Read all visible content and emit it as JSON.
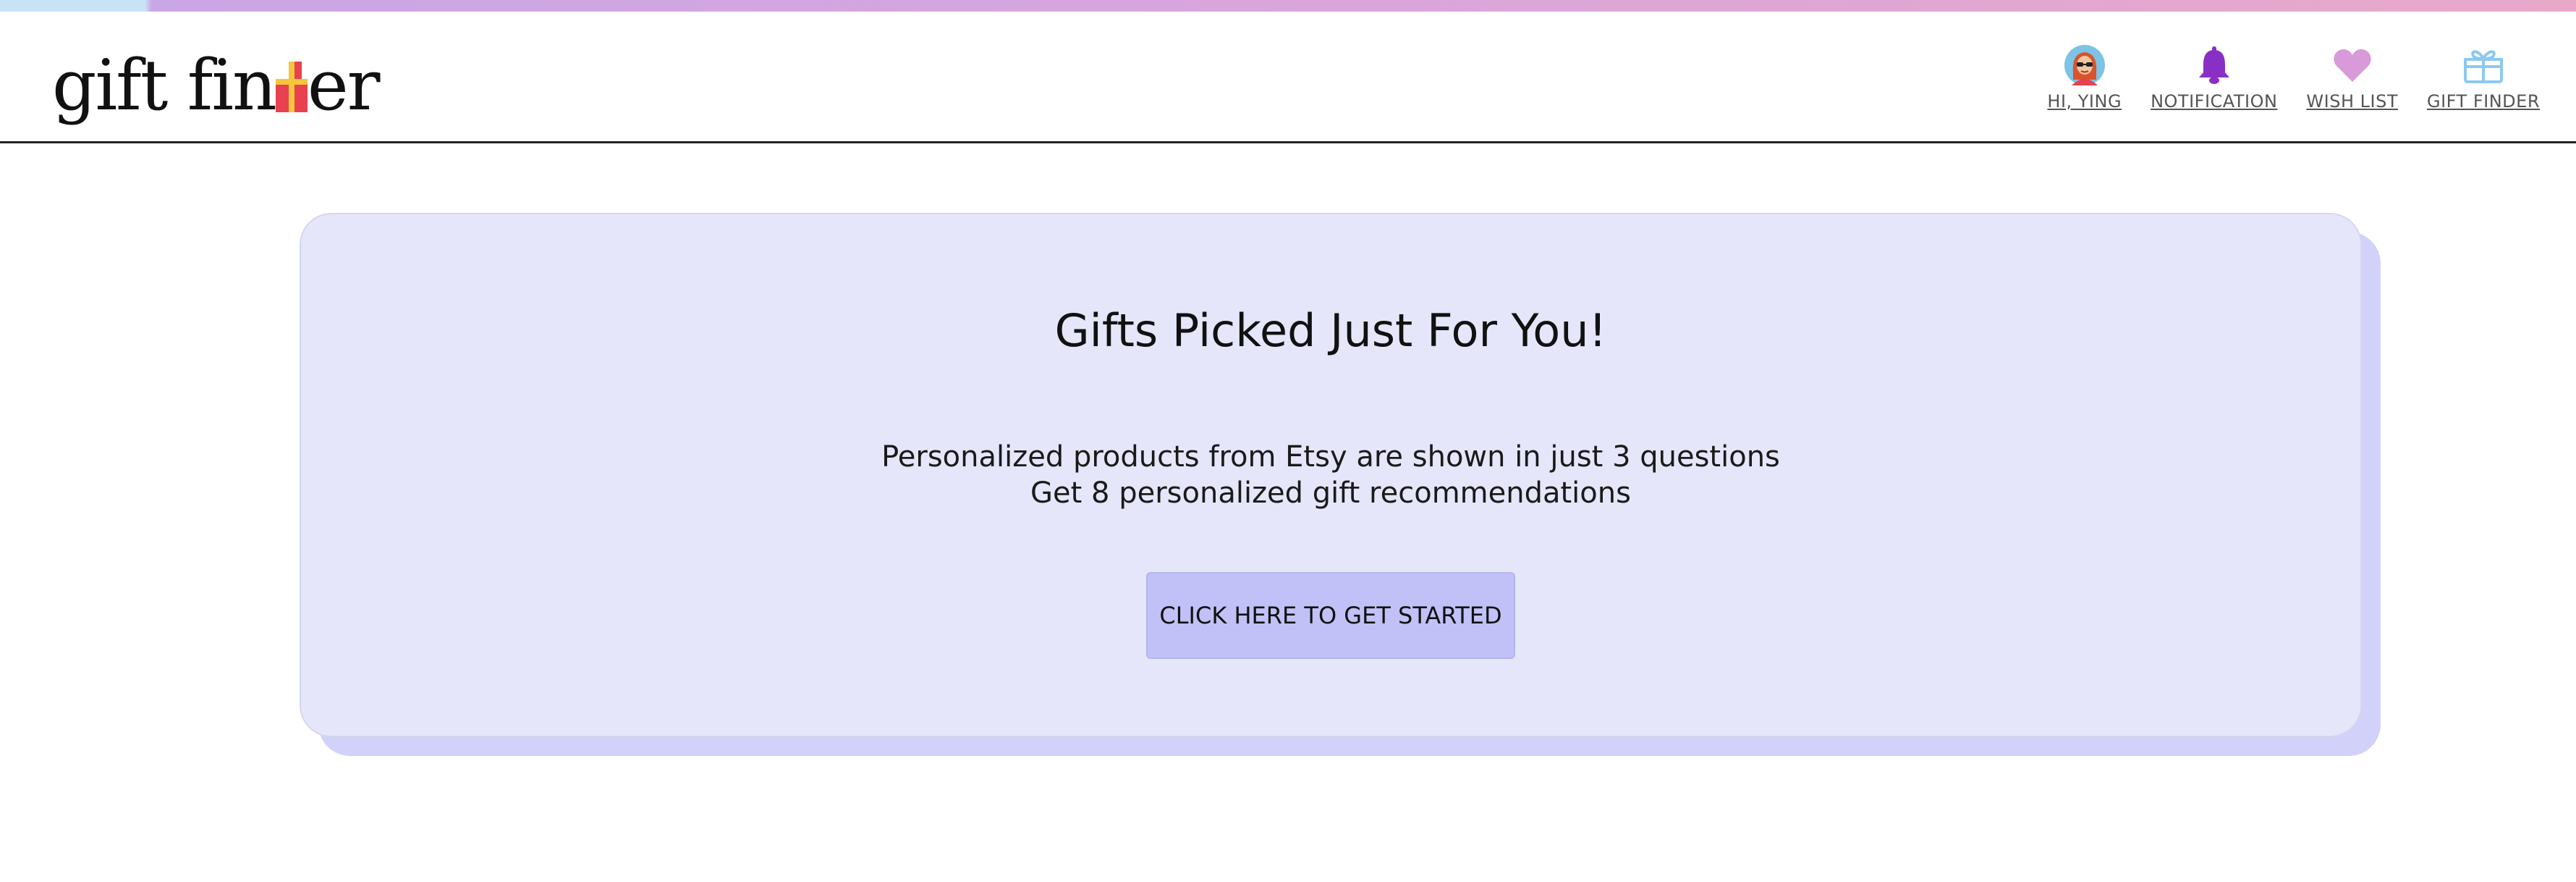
{
  "brand": {
    "logo_text_left": "gift fin",
    "logo_text_right": "er"
  },
  "nav": {
    "profile_label": "HI, YING",
    "notification_label": "NOTIFICATION",
    "wishlist_label": "WISH LIST",
    "giftfinder_label": "GIFT FINDER"
  },
  "hero": {
    "title": "Gifts Picked Just For You!",
    "line_1": "Personalized products from Etsy are shown in just 3 questions",
    "line_2": "Get 8 personalized gift recommendations",
    "cta_label": "CLICK HERE TO GET STARTED"
  },
  "colors": {
    "card_background": "#e6e6fb",
    "card_shadow": "#d1d1f9",
    "cta_background": "#c1c1f8",
    "bell_icon": "#8a2fc4",
    "heart_icon": "#d89ad9",
    "gift_icon": "#8ec9ee"
  },
  "icons": {
    "profile": "avatar-icon",
    "notification": "bell-icon",
    "wishlist": "heart-icon",
    "giftfinder": "gift-icon"
  }
}
